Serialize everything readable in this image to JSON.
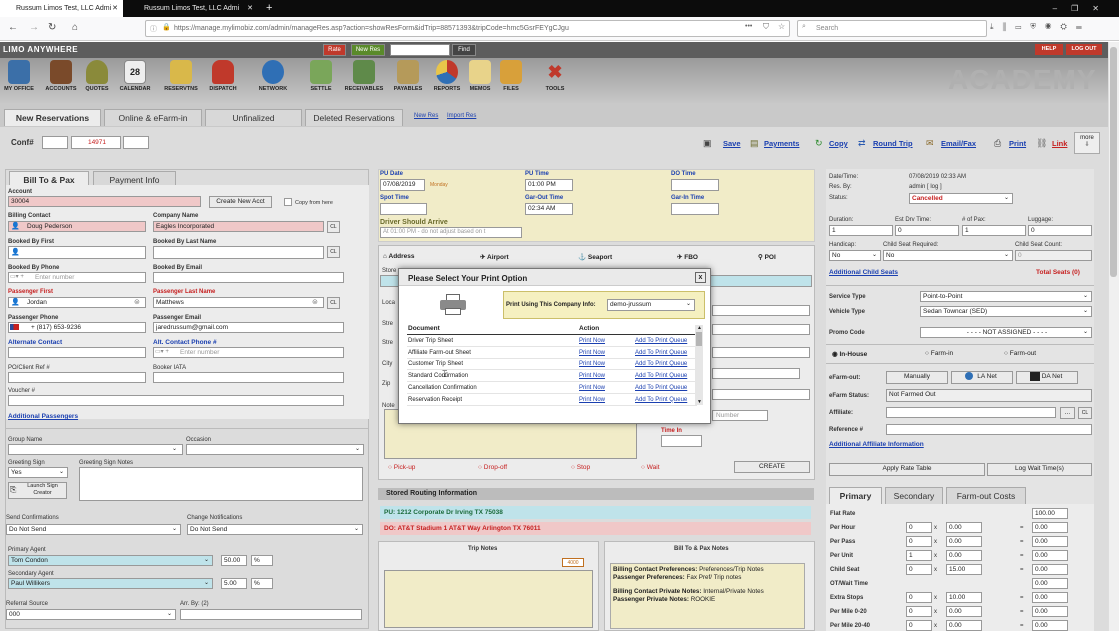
{
  "browser": {
    "tabs": [
      {
        "label": "Russum Limos Test, LLC Admi"
      },
      {
        "label": "Russum Limos Test, LLC Admi"
      }
    ],
    "url": "https://manage.mylimobiz.com/admin/manageRes.asp?action=showResForm&idTrip=88571393&tripCode=hmc5GsrFEYgCJgu",
    "search_placeholder": "Search"
  },
  "app": {
    "brand": "LIMO ANYWHERE",
    "top_buttons": {
      "rate": "Rate",
      "new_res": "New Res",
      "find": "Find",
      "help": "HELP",
      "logout": "LOG OUT"
    },
    "brand_right": "ACADEMY",
    "icons": [
      "MY OFFICE",
      "ACCOUNTS",
      "QUOTES",
      "CALENDAR",
      "RESERVTNS",
      "DISPATCH",
      "NETWORK",
      "SETTLE",
      "RECEIVABLES",
      "PAYABLES",
      "REPORTS",
      "MEMOS",
      "FILES",
      "TOOLS"
    ],
    "calendar_day": "28"
  },
  "tabs": {
    "new_res": "New Reservations",
    "online": "Online & eFarm-in",
    "unfinalized": "Unfinalized",
    "deleted": "Deleted Reservations",
    "new_res_link": "New Res",
    "import_res_link": "Import Res"
  },
  "conf": {
    "label": "Conf#",
    "number": "14971"
  },
  "toolbar": {
    "save": "Save",
    "payments": "Payments",
    "copy": "Copy",
    "round_trip": "Round Trip",
    "email_fax": "Email/Fax",
    "print": "Print",
    "link": "Link",
    "more": "more"
  },
  "left": {
    "tab_bill": "Bill To & Pax",
    "tab_payment": "Payment Info",
    "account_label": "Account",
    "account": "30004",
    "create_acct": "Create New Acct",
    "copy_from": "Copy from here",
    "billing_contact_label": "Billing Contact",
    "billing_contact": "Doug Pederson",
    "company_label": "Company Name",
    "company": "Eagles Incorporated",
    "cl": "CL",
    "booked_first": "Booked By First",
    "booked_last": "Booked By Last Name",
    "booked_phone": "Booked By Phone",
    "booked_email": "Booked By Email",
    "enter_number": "Enter number",
    "pax_first_label": "Passenger First",
    "pax_first": "Jordan",
    "pax_last_label": "Passenger Last Name",
    "pax_last": "Matthews",
    "pax_phone_label": "Passenger Phone",
    "pax_phone": "+ (817) 653-9236",
    "pax_email_label": "Passenger Email",
    "pax_email": "jaredrussum@gmail.com",
    "alt_contact": "Alternate Contact",
    "alt_phone": "Alt. Contact Phone #",
    "po_label": "PO/Client Ref #",
    "booker_iata": "Booker IATA",
    "voucher": "Voucher #",
    "additional_pax": "Additional Passengers",
    "group_name": "Group Name",
    "occasion": "Occasion",
    "greeting_sign": "Greeting Sign",
    "greeting_value": "Yes",
    "greeting_notes": "Greeting Sign Notes",
    "launch": "Launch Sign Creator",
    "send_conf": "Send Confirmations",
    "send_conf_val": "Do Not Send",
    "change_notif": "Change Notifications",
    "change_notif_val": "Do Not Send",
    "primary_agent": "Primary Agent",
    "primary_agent_val": "Tom Condon",
    "primary_pct": "50.00",
    "pct": "%",
    "secondary_agent": "Secondary Agent",
    "secondary_agent_val": "Paul Willikers",
    "secondary_pct": "5.00",
    "referral": "Referral Source",
    "referral_val": "000",
    "arr_by": "Arr. By: (2)"
  },
  "middle": {
    "pu_date_label": "PU Date",
    "pu_date": "07/08/2019",
    "monday": "Monday",
    "pu_time_label": "PU Time",
    "pu_time": "01:00 PM",
    "do_time_label": "DO Time",
    "spot_time": "Spot Time",
    "garout_label": "Gar-Out Time",
    "garout": "02:34 AM",
    "garin": "Gar-In Time",
    "should_arrive": "Driver Should Arrive",
    "should_arrive_val": "At 01:00 PM - do not adjust based on t",
    "loc_types": [
      "Address",
      "Airport",
      "Seaport",
      "FBO",
      "POI"
    ],
    "stop_types": [
      "Pick-up",
      "Drop-off",
      "Stop",
      "Wait"
    ],
    "create": "CREATE",
    "time_in": "Time In",
    "number_ph": "Number",
    "routing_hdr": "Stored Routing Information",
    "pu_route": "PU: 1212 Corporate Dr Irving TX 75038",
    "do_route": "DO: AT&T Stadium 1 AT&T Way Arlington TX 76011",
    "trip_notes": "Trip Notes",
    "trip_notes_count": "4000",
    "bill_pax_notes": "Bill To & Pax Notes",
    "notes": [
      {
        "k": "Billing Contact Preferences:",
        "v": "Preferences/Trip Notes"
      },
      {
        "k": "Passenger Preferences:",
        "v": "Fax Pref/ Trip notes"
      },
      {
        "k": "Billing Contact Private Notes:",
        "v": "Internal/Private Notes"
      },
      {
        "k": "Passenger Private Notes:",
        "v": "ROOKIE"
      }
    ],
    "stub_labels": [
      "Store",
      "Loca",
      "Stre",
      "Stre",
      "City",
      "Zip",
      "Note"
    ]
  },
  "modal": {
    "title": "Please Select Your Print Option",
    "close": "x",
    "company_label": "Print Using This Company Info:",
    "company_val": "demo-jrussum",
    "col_doc": "Document",
    "col_action": "Action",
    "rows": [
      {
        "doc": "Driver Trip Sheet",
        "print": "Print Now",
        "queue": "Add To Print Queue"
      },
      {
        "doc": "Affiliate Farm-out Sheet",
        "print": "Print Now",
        "queue": "Add To Print Queue"
      },
      {
        "doc": "Customer Trip Sheet",
        "print": "Print Now",
        "queue": "Add To Print Queue"
      },
      {
        "doc": "Standard Confirmation",
        "print": "Print Now",
        "queue": "Add To Print Queue"
      },
      {
        "doc": "Cancellation Confirmation",
        "print": "Print Now",
        "queue": "Add To Print Queue"
      },
      {
        "doc": "Reservation Receipt",
        "print": "Print Now",
        "queue": "Add To Print Queue"
      }
    ]
  },
  "right": {
    "date_time_label": "Date/Time:",
    "date_time": "07/08/2019 02:33 AM",
    "res_by_label": "Res. By:",
    "res_by": "admin [ log ]",
    "status_label": "Status:",
    "status": "Cancelled",
    "duration": "Duration:",
    "duration_val": "1",
    "est_drv": "Est Drv Time:",
    "est_drv_val": "0",
    "num_pax": "# of Pax:",
    "num_pax_val": "1",
    "luggage": "Luggage:",
    "luggage_val": "0",
    "handicap": "Handicap:",
    "handicap_val": "No",
    "child_req": "Child Seat Required:",
    "child_req_val": "No",
    "child_count": "Child Seat Count:",
    "child_count_val": "0",
    "add_child": "Additional Child Seats",
    "total_seats": "Total Seats (0)",
    "service_type": "Service Type",
    "service_val": "Point-to-Point",
    "vehicle_type": "Vehicle Type",
    "vehicle_val": "Sedan Towncar (SED)",
    "promo": "Promo Code",
    "promo_val": "- - - - NOT ASSIGNED - - - -",
    "inhouse": "In-House",
    "farmin": "Farm-in",
    "farmout": "Farm-out",
    "efarm": "eFarm-out:",
    "manually": "Manually",
    "la_net": "LA Net",
    "da_net": "DA Net",
    "efarm_status": "eFarm Status:",
    "efarm_status_val": "Not Farmed Out",
    "affiliate": "Affiliate:",
    "reference": "Reference #",
    "add_affiliate": "Additional Affiliate Information",
    "apply_rate": "Apply Rate Table",
    "log_wait": "Log Wait Time(s)",
    "rate_tabs": [
      "Primary",
      "Secondary",
      "Farm-out Costs"
    ],
    "rates": [
      {
        "label": "Flat Rate",
        "a": "",
        "b": "",
        "total": "100.00"
      },
      {
        "label": "Per Hour",
        "a": "0",
        "b": "0.00",
        "total": "0.00"
      },
      {
        "label": "Per Pass",
        "a": "0",
        "b": "0.00",
        "total": "0.00"
      },
      {
        "label": "Per Unit",
        "a": "1",
        "b": "0.00",
        "total": "0.00"
      },
      {
        "label": "Child Seat",
        "a": "0",
        "b": "15.00",
        "total": "0.00"
      },
      {
        "label": "OT/Wait Time",
        "a": "",
        "b": "",
        "total": "0.00"
      },
      {
        "label": "Extra Stops",
        "a": "0",
        "b": "10.00",
        "total": "0.00"
      },
      {
        "label": "Per Mile 0-20",
        "a": "0",
        "b": "0.00",
        "total": "0.00"
      },
      {
        "label": "Per Mile 20-40",
        "a": "0",
        "b": "0.00",
        "total": "0.00"
      }
    ],
    "x": "x",
    "eq": "="
  },
  "colors": {
    "accent_red": "#c62020",
    "link_blue": "#1a3fb0",
    "bar_gray": "#5d5d5d"
  }
}
